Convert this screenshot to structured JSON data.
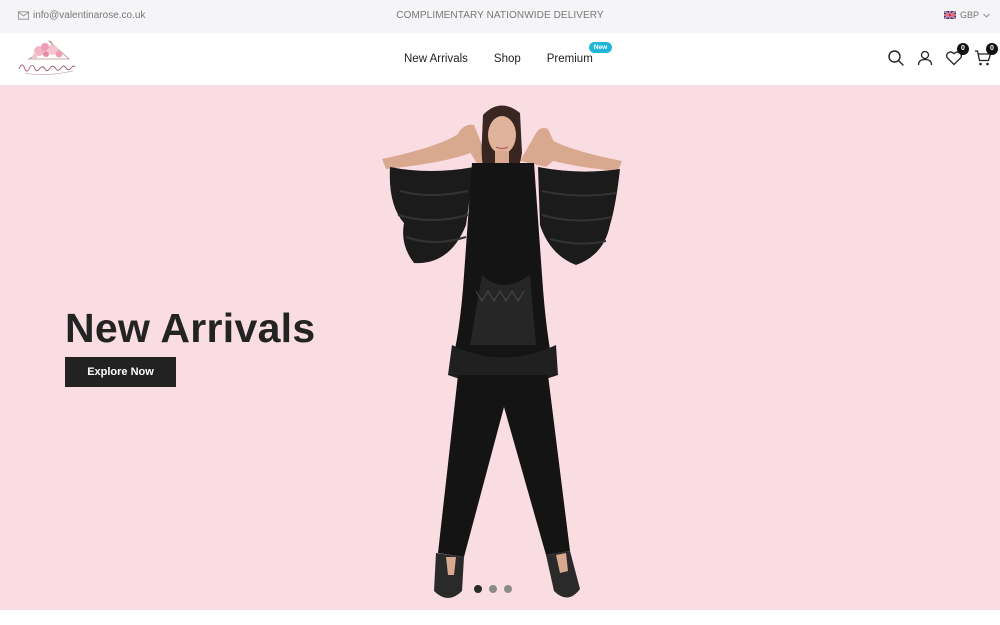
{
  "topbar": {
    "email": "info@valentinarose.co.uk",
    "delivery": "COMPLIMENTARY NATIONWIDE DELIVERY",
    "currency": "GBP"
  },
  "header": {
    "logo_text": "ValentinaRose",
    "nav": [
      {
        "label": "New Arrivals"
      },
      {
        "label": "Shop"
      },
      {
        "label": "Premium",
        "badge": "New"
      }
    ],
    "wishlist_count": "0",
    "cart_count": "0"
  },
  "hero": {
    "title": "New Arrivals",
    "button": "Explore Now",
    "background": "#fadde3",
    "slides": 3,
    "active_slide": 1
  },
  "colors": {
    "badge": "#21b6d9",
    "button": "#222222",
    "accent_pink": "#f2b8c6"
  },
  "icons": [
    "mail-icon",
    "uk-flag-icon",
    "chevron-down-icon",
    "search-icon",
    "user-icon",
    "heart-icon",
    "cart-icon"
  ]
}
